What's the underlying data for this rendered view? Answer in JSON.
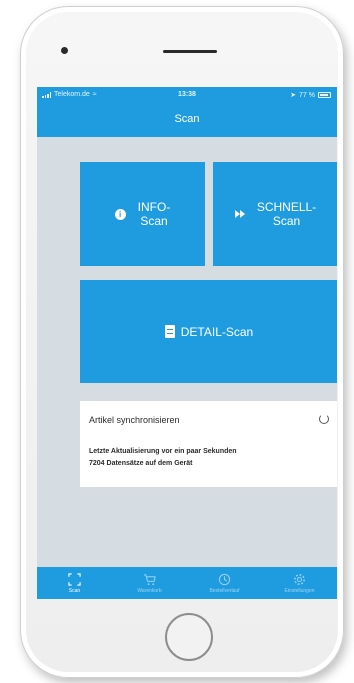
{
  "status_bar": {
    "carrier": "Telekom.de",
    "time": "13:38",
    "battery": "77 %"
  },
  "nav": {
    "title": "Scan"
  },
  "tiles": {
    "info": {
      "line1": "INFO-",
      "line2": "Scan",
      "icon": "info-icon"
    },
    "schnell": {
      "line1": "SCHNELL-",
      "line2": "Scan",
      "icon": "fast-forward-icon"
    },
    "detail": {
      "label": "DETAIL-Scan",
      "icon": "document-icon"
    }
  },
  "sync": {
    "title": "Artikel synchronisieren",
    "last_update": "Letzte Aktualisierung vor ein paar Sekunden",
    "records": "7204 Datensätze auf dem Gerät",
    "icon": "refresh-icon"
  },
  "tabs": [
    {
      "label": "Scan",
      "icon": "scan-frame-icon",
      "active": true
    },
    {
      "label": "Warenkorb",
      "icon": "cart-icon",
      "active": false
    },
    {
      "label": "Bestellverlauf",
      "icon": "history-icon",
      "active": false
    },
    {
      "label": "Einstellungen",
      "icon": "settings-gear-icon",
      "active": false
    }
  ],
  "colors": {
    "primary": "#1f9ce0",
    "screen_background": "#d6dde2",
    "card_background": "#ffffff"
  }
}
